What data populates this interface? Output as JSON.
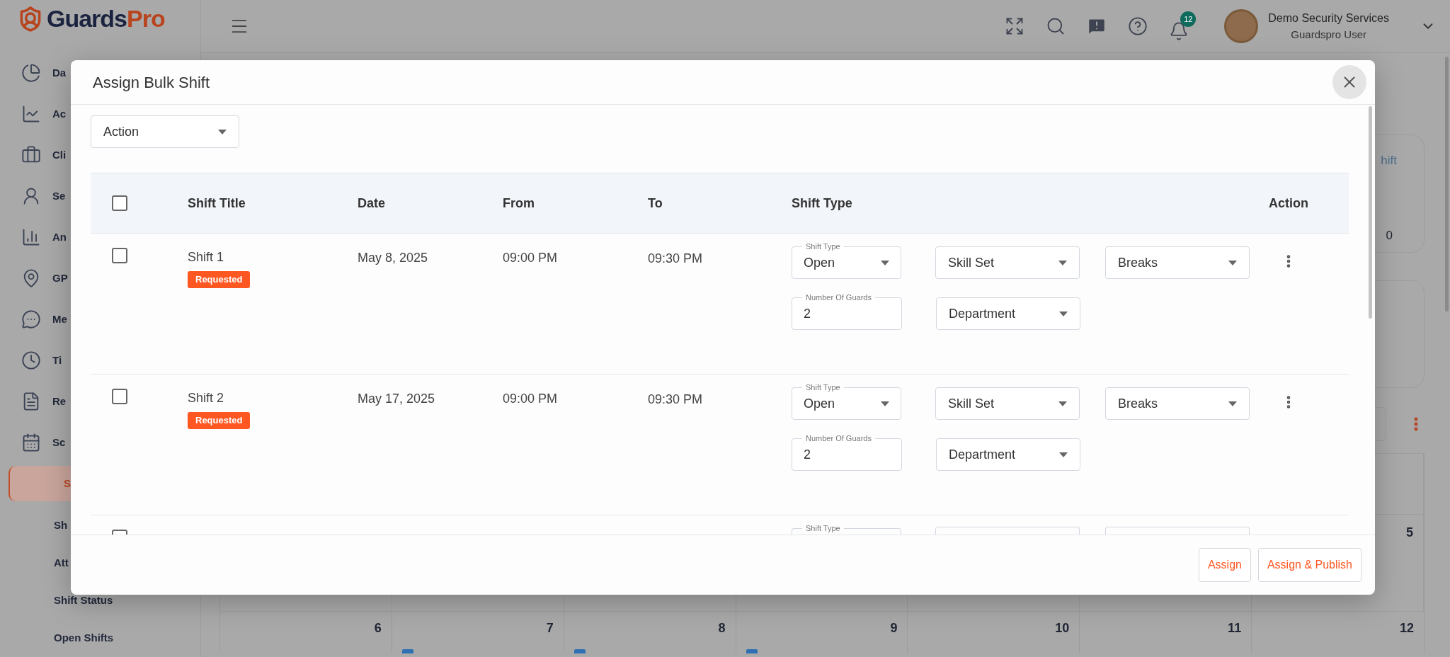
{
  "logo": {
    "word_1": "Guards",
    "word_2": "Pro"
  },
  "sidebar": {
    "items": [
      {
        "label": "Da",
        "selected": false
      },
      {
        "label": "Ac",
        "selected": false
      },
      {
        "label": "Cli",
        "selected": false
      },
      {
        "label": "Se",
        "selected": false
      },
      {
        "label": "An",
        "selected": false
      },
      {
        "label": "GP",
        "selected": false
      },
      {
        "label": "Me",
        "selected": false
      },
      {
        "label": "Ti",
        "selected": false
      },
      {
        "label": "Re",
        "selected": false
      },
      {
        "label": "Sc",
        "selected": false
      },
      {
        "label": "S",
        "selected": true
      }
    ],
    "sub_items": [
      "Sh",
      "Att",
      "Shift Status",
      "Open Shifts"
    ]
  },
  "header": {
    "notifications_count": "12",
    "user_name": "Demo Security Services",
    "user_role": "Guardspro User"
  },
  "background": {
    "card_link": "hift",
    "card_value": "0",
    "calendar_week_1": [
      {
        "day": "5",
        "event": false
      }
    ],
    "calendar_week_2": [
      {
        "day": "6",
        "event": false
      },
      {
        "day": "7",
        "event": true
      },
      {
        "day": "8",
        "event": true
      },
      {
        "day": "9",
        "event": true
      },
      {
        "day": "10",
        "event": false
      },
      {
        "day": "11",
        "event": false
      },
      {
        "day": "12",
        "event": false
      }
    ]
  },
  "modal": {
    "title": "Assign Bulk Shift",
    "action_select": {
      "placeholder": "Action"
    },
    "columns": [
      "Shift Title",
      "Date",
      "From",
      "To",
      "Shift Type",
      "Action"
    ],
    "all_checked": false,
    "rows": [
      {
        "kind": "full",
        "checked": false,
        "title": "Shift 1",
        "status": "Requested",
        "date": "May 8, 2025",
        "from": "09:00 PM",
        "to": "09:30 PM",
        "shift_type": {
          "label": "Shift Type",
          "value": "Open"
        },
        "skill_set": {
          "placeholder": "Skill Set"
        },
        "breaks": {
          "placeholder": "Breaks"
        },
        "guards": {
          "label": "Number Of Guards",
          "value": "2"
        },
        "department": {
          "placeholder": "Department"
        }
      },
      {
        "kind": "full",
        "checked": false,
        "title": "Shift 2",
        "status": "Requested",
        "date": "May 17, 2025",
        "from": "09:00 PM",
        "to": "09:30 PM",
        "shift_type": {
          "label": "Shift Type",
          "value": "Open"
        },
        "skill_set": {
          "placeholder": "Skill Set"
        },
        "breaks": {
          "placeholder": "Breaks"
        },
        "guards": {
          "label": "Number Of Guards",
          "value": "2"
        },
        "department": {
          "placeholder": "Department"
        }
      },
      {
        "kind": "partial",
        "checked": false,
        "shift_type": {
          "label": "Shift Type"
        }
      }
    ],
    "buttons": [
      "Assign",
      "Assign & Publish"
    ]
  }
}
